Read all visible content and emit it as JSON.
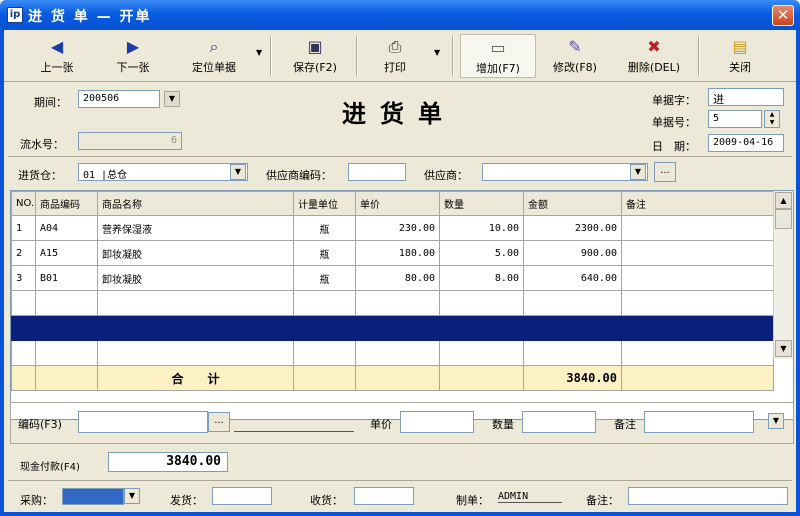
{
  "window": {
    "icon_text": "ip",
    "title": "进 货 单 — 开单",
    "close_glyph": "✕"
  },
  "toolbar": {
    "buttons": [
      {
        "label": "上一张",
        "icon": "prev-arrow-icon",
        "glyph": "◀"
      },
      {
        "label": "下一张",
        "icon": "next-arrow-icon",
        "glyph": "▶"
      },
      {
        "label": "定位单据",
        "icon": "binoculars-icon",
        "glyph": "⌕"
      },
      {
        "label": "保存(F2)",
        "icon": "save-icon",
        "glyph": "▣"
      },
      {
        "label": "打印",
        "icon": "printer-icon",
        "glyph": "⎙"
      },
      {
        "label": "增加(F7)",
        "icon": "new-document-icon",
        "glyph": "▭"
      },
      {
        "label": "修改(F8)",
        "icon": "edit-icon",
        "glyph": "✎"
      },
      {
        "label": "删除(DEL)",
        "icon": "delete-icon",
        "glyph": "✖"
      },
      {
        "label": "关闭",
        "icon": "close-folder-icon",
        "glyph": "▤"
      }
    ],
    "dropdown_glyph": "▼"
  },
  "header": {
    "period_label": "期间：",
    "period_value": "200506",
    "doc_title": "进货单",
    "serial_label": "流水号：",
    "serial_value": "6",
    "doc_word_label": "单据字：",
    "doc_word_value": "进",
    "doc_no_label": "单据号：",
    "doc_no_value": "5",
    "date_label": "日　期：",
    "date_value": "2009-04-16",
    "warehouse_label": "进货仓：",
    "warehouse_value": "01 |总仓",
    "supplier_code_label": "供应商编码：",
    "supplier_code_value": "",
    "supplier_label": "供应商：",
    "supplier_value": "",
    "ellipsis": "..."
  },
  "grid": {
    "columns": [
      "NO.",
      "商品编码",
      "商品名称",
      "计量单位",
      "单价",
      "数量",
      "金额",
      "备注"
    ],
    "rows": [
      {
        "no": "1",
        "code": "A04",
        "name": "营养保湿液",
        "unit": "瓶",
        "price": "230.00",
        "qty": "10.00",
        "amount": "2300.00",
        "note": ""
      },
      {
        "no": "2",
        "code": "A15",
        "name": "卸妆凝胶",
        "unit": "瓶",
        "price": "180.00",
        "qty": "5.00",
        "amount": "900.00",
        "note": ""
      },
      {
        "no": "3",
        "code": "B01",
        "name": "卸妆凝胶",
        "unit": "瓶",
        "price": "80.00",
        "qty": "8.00",
        "amount": "640.00",
        "note": ""
      }
    ],
    "total_label": "合　　计",
    "total_amount": "3840.00"
  },
  "entry": {
    "code_label": "编码(F3)",
    "price_label": "单价",
    "qty_label": "数量",
    "note_label": "备注"
  },
  "payment": {
    "cash_label": "现金付款(F4)",
    "cash_value": "3840.00"
  },
  "footer": {
    "purchase_label": "采购：",
    "ship_label": "发货：",
    "receive_label": "收货：",
    "maker_label": "制单：",
    "maker_value": "ADMIN",
    "note_label": "备注："
  },
  "colors": {
    "titlebar": "#0a5ce0",
    "selected_row": "#0a1f7a",
    "total_row": "#fcf1c3",
    "client_bg": "#ece9d8"
  }
}
